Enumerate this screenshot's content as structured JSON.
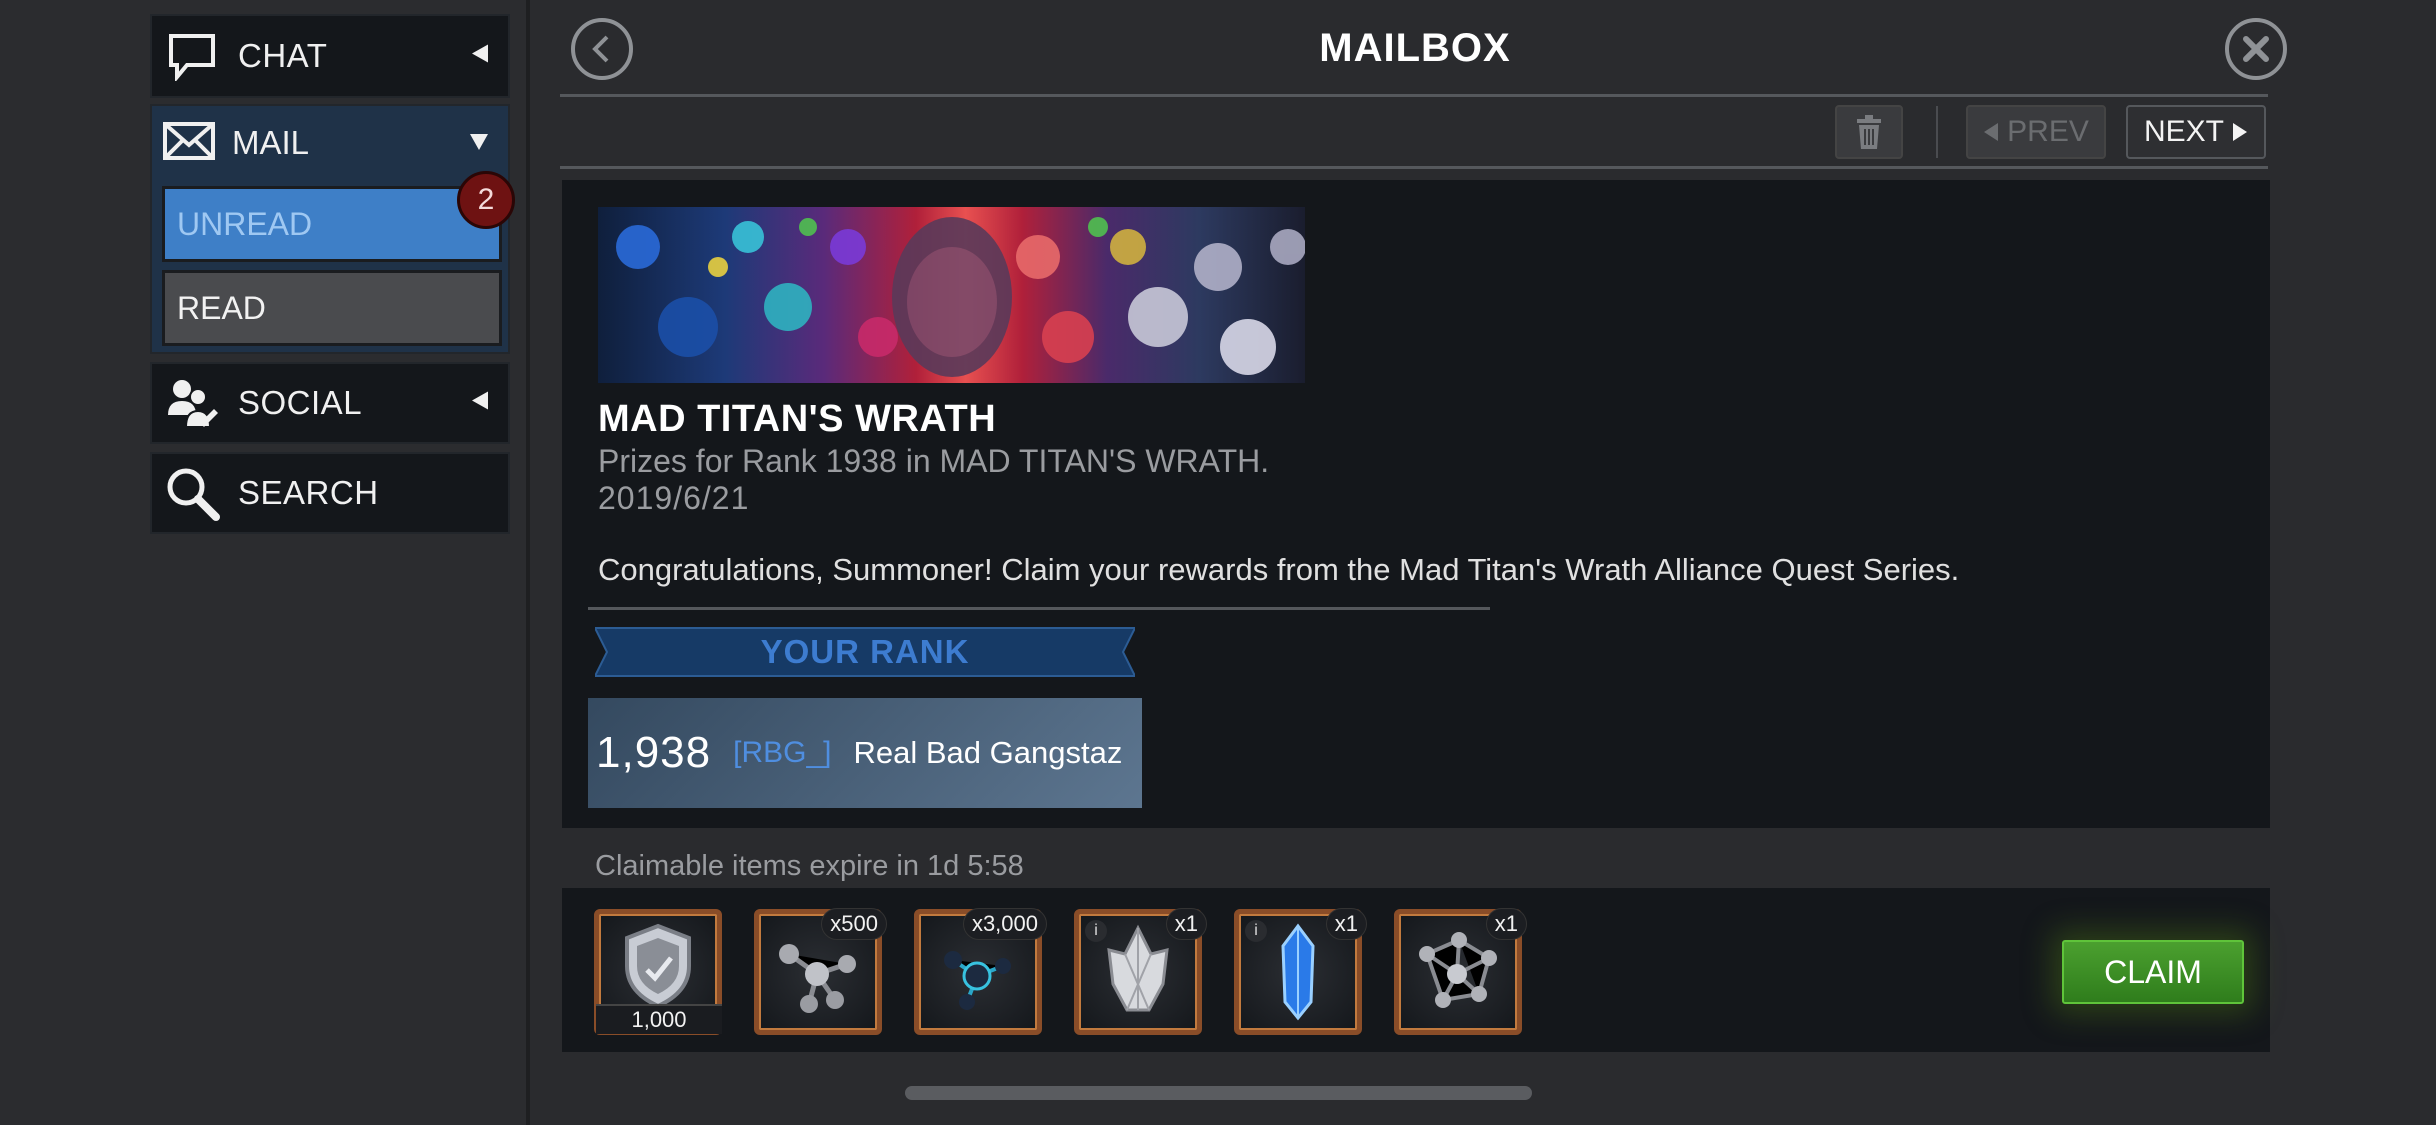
{
  "sidebar": {
    "chat_label": "CHAT",
    "mail_label": "MAIL",
    "unread_label": "UNREAD",
    "unread_count": "2",
    "read_label": "READ",
    "social_label": "SOCIAL",
    "search_label": "SEARCH"
  },
  "header": {
    "title": "MAILBOX",
    "prev_label": "PREV",
    "next_label": "NEXT"
  },
  "mail": {
    "title": "MAD TITAN'S WRATH",
    "subtitle": "Prizes for Rank 1938 in MAD TITAN'S WRATH.",
    "date": "2019/6/21",
    "body": "Congratulations, Summoner! Claim your rewards from the Mad Titan's Wrath Alliance Quest Series.",
    "rank_heading": "YOUR RANK",
    "rank_value": "1,938",
    "alliance_tag": "[RBG_]",
    "alliance_name": "Real Bad Gangstaz"
  },
  "rewards": {
    "expire_text": "Claimable items expire in 1d 5:58",
    "items": [
      {
        "icon": "shield-icon",
        "quantity": "1,000"
      },
      {
        "icon": "catalyst-fragment-icon",
        "count": "x500"
      },
      {
        "icon": "blue-catalyst-fragment-icon",
        "count": "x3,000"
      },
      {
        "icon": "crystal-icon",
        "count": "x1"
      },
      {
        "icon": "blue-crystal-shard-icon",
        "count": "x1"
      },
      {
        "icon": "catalyst-icon",
        "count": "x1"
      }
    ],
    "claim_label": "CLAIM"
  }
}
